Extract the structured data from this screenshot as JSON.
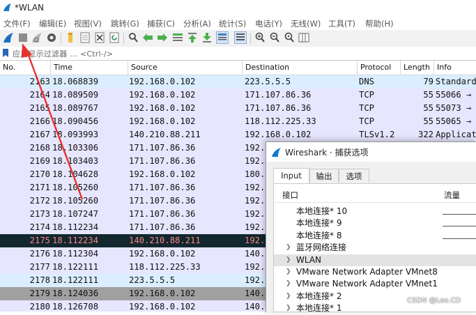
{
  "window": {
    "title": "*WLAN"
  },
  "menu": [
    "文件(F)",
    "编辑(E)",
    "视图(V)",
    "跳转(G)",
    "捕获(C)",
    "分析(A)",
    "统计(S)",
    "电话(Y)",
    "无线(W)",
    "工具(T)",
    "帮助(H)"
  ],
  "toolbar": {
    "icons": [
      "shark-fin-start-icon",
      "stop-square-icon",
      "restart-fin-icon",
      "capture-options-gear-icon",
      "open-folder-icon",
      "save-file-icon",
      "close-file-icon",
      "reload-icon",
      "find-magnifier-icon",
      "go-back-arrow-icon",
      "go-forward-arrow-icon",
      "go-to-packet-icon",
      "go-first-icon",
      "go-last-icon",
      "auto-scroll-icon",
      "colorize-icon",
      "zoom-in-icon",
      "zoom-out-icon",
      "zoom-normal-icon",
      "resize-columns-icon"
    ]
  },
  "filter": {
    "placeholder": "应用显示过滤器 … <Ctrl-/>"
  },
  "packet_list": {
    "columns": [
      "No.",
      "Time",
      "Source",
      "Destination",
      "Protocol",
      "Length",
      "Info"
    ],
    "rows": [
      {
        "no": "2163",
        "time": "18.068839",
        "src": "192.168.0.102",
        "dst": "223.5.5.5",
        "proto": "DNS",
        "len": "79",
        "info": "Standard"
      },
      {
        "no": "2164",
        "time": "18.089509",
        "src": "192.168.0.102",
        "dst": "171.107.86.36",
        "proto": "TCP",
        "len": "55",
        "info": "55066 →"
      },
      {
        "no": "2165",
        "time": "18.089767",
        "src": "192.168.0.102",
        "dst": "171.107.86.36",
        "proto": "TCP",
        "len": "55",
        "info": "55073 →"
      },
      {
        "no": "2166",
        "time": "18.090456",
        "src": "192.168.0.102",
        "dst": "118.112.225.33",
        "proto": "TCP",
        "len": "55",
        "info": "55065 →"
      },
      {
        "no": "2167",
        "time": "18.093993",
        "src": "140.210.88.211",
        "dst": "192.168.0.102",
        "proto": "TLSv1.2",
        "len": "322",
        "info": "Applicat"
      },
      {
        "no": "2168",
        "time": "18.103306",
        "src": "171.107.86.36",
        "dst": "192.",
        "proto": "",
        "len": "",
        "info": ""
      },
      {
        "no": "2169",
        "time": "18.103403",
        "src": "171.107.86.36",
        "dst": "192.",
        "proto": "",
        "len": "",
        "info": ""
      },
      {
        "no": "2170",
        "time": "18.104628",
        "src": "192.168.0.102",
        "dst": "180.",
        "proto": "",
        "len": "",
        "info": ""
      },
      {
        "no": "2171",
        "time": "18.105260",
        "src": "171.107.86.36",
        "dst": "192.",
        "proto": "",
        "len": "",
        "info": ""
      },
      {
        "no": "2172",
        "time": "18.105260",
        "src": "171.107.86.36",
        "dst": "192.",
        "proto": "",
        "len": "",
        "info": ""
      },
      {
        "no": "2173",
        "time": "18.107247",
        "src": "171.107.86.36",
        "dst": "192.",
        "proto": "",
        "len": "",
        "info": ""
      },
      {
        "no": "2174",
        "time": "18.112234",
        "src": "171.107.86.36",
        "dst": "192.",
        "proto": "",
        "len": "",
        "info": ""
      },
      {
        "no": "2175",
        "time": "18.112234",
        "src": "140.210.88.211",
        "dst": "192.",
        "proto": "",
        "len": "",
        "info": ""
      },
      {
        "no": "2176",
        "time": "18.112304",
        "src": "192.168.0.102",
        "dst": "140.",
        "proto": "",
        "len": "",
        "info": ""
      },
      {
        "no": "2177",
        "time": "18.122111",
        "src": "118.112.225.33",
        "dst": "192.",
        "proto": "",
        "len": "",
        "info": ""
      },
      {
        "no": "2178",
        "time": "18.122111",
        "src": "223.5.5.5",
        "dst": "192.",
        "proto": "",
        "len": "",
        "info": ""
      },
      {
        "no": "2179",
        "time": "18.124036",
        "src": "192.168.0.102",
        "dst": "140.",
        "proto": "",
        "len": "",
        "info": ""
      },
      {
        "no": "2180",
        "time": "18.126708",
        "src": "192.168.0.102",
        "dst": "140.",
        "proto": "",
        "len": "",
        "info": ""
      }
    ]
  },
  "row_colors": {
    "tcp": "#e7e6ff",
    "dns": "#daeeff",
    "tls": "#e7e6ff",
    "selected_bg": "#12272e",
    "selected_fg": "#f78787",
    "gray_bg": "#a0a0a0"
  },
  "dialog": {
    "title": "Wireshark · 捕获选项",
    "tabs": [
      "Input",
      "输出",
      "选项"
    ],
    "active_tab": "Input",
    "header": {
      "interface": "接口",
      "traffic": "流量"
    },
    "interfaces": [
      {
        "name": "本地连接* 10",
        "expandable": false,
        "selected": false
      },
      {
        "name": "本地连接* 9",
        "expandable": false,
        "selected": false
      },
      {
        "name": "本地连接* 8",
        "expandable": false,
        "selected": false
      },
      {
        "name": "蓝牙网络连接",
        "expandable": true,
        "selected": false
      },
      {
        "name": "WLAN",
        "expandable": true,
        "selected": true
      },
      {
        "name": "VMware Network Adapter VMnet8",
        "expandable": true,
        "selected": false
      },
      {
        "name": "VMware Network Adapter VMnet1",
        "expandable": true,
        "selected": false
      },
      {
        "name": "本地连接* 2",
        "expandable": true,
        "selected": false
      },
      {
        "name": "本地连接* 1",
        "expandable": true,
        "selected": false
      }
    ]
  },
  "watermark": "CSDN @Lee.CD",
  "annotation": {
    "arrow_color": "#e8322c"
  }
}
